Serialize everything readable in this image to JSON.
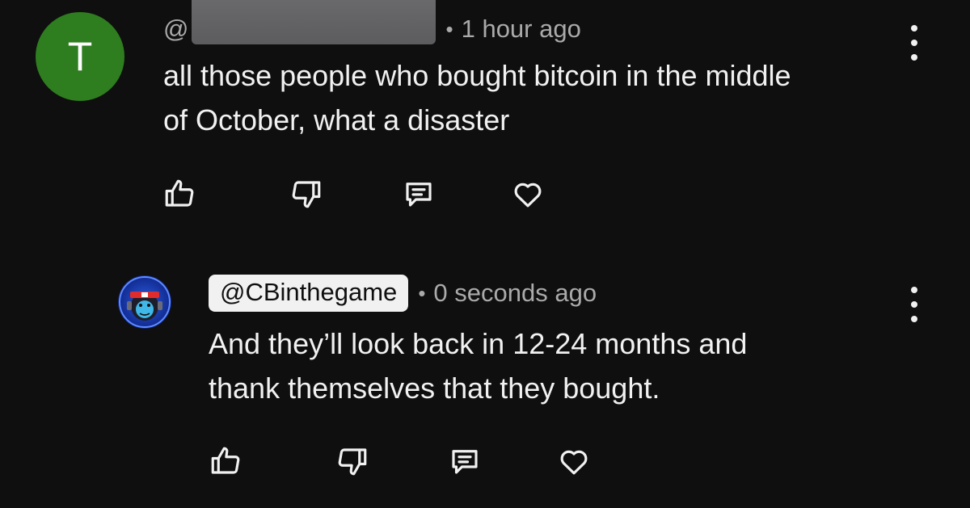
{
  "comments": [
    {
      "avatar_letter": "T",
      "avatar_color": "#2e7d1f",
      "handle_prefix": "@",
      "handle_redacted": true,
      "timestamp": "1 hour ago",
      "text_lines": [
        "all those people who bought bitcoin in the middle",
        "of October, what a disaster"
      ],
      "actions": [
        "thumbs-up-icon",
        "thumbs-down-icon",
        "reply-icon",
        "heart-icon"
      ]
    },
    {
      "avatar_icon": "gorilla-avatar",
      "handle": "@CBinthegame",
      "timestamp": "0 seconds ago",
      "text_lines": [
        "And they’ll look back in 12-24 months and",
        "thank themselves that they bought."
      ],
      "actions": [
        "thumbs-up-icon",
        "thumbs-down-icon",
        "reply-icon",
        "heart-icon"
      ]
    }
  ],
  "colors": {
    "background": "#0f0f0f",
    "text": "#f1f1f1",
    "meta": "#aaaaaa",
    "chip_bg": "#f1f1f1",
    "redaction": "#646466"
  }
}
